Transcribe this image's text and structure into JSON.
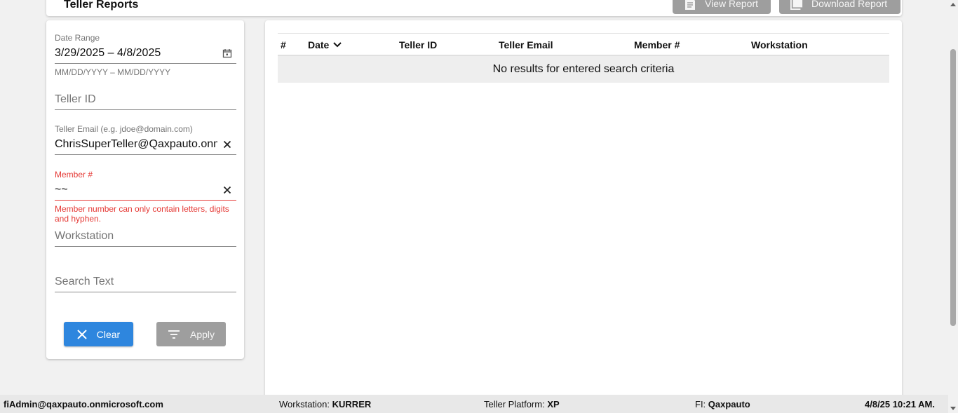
{
  "header": {
    "title": "Teller Reports",
    "view_report_label": "View Report",
    "download_report_label": "Download Report"
  },
  "filters": {
    "date_range": {
      "label": "Date Range",
      "value": "3/29/2025 – 4/8/2025",
      "helper": "MM/DD/YYYY – MM/DD/YYYY"
    },
    "teller_id": {
      "placeholder": "Teller ID"
    },
    "teller_email": {
      "label": "Teller Email (e.g. jdoe@domain.com)",
      "value": "ChrisSuperTeller@Qaxpauto.onmicrosoft.com"
    },
    "member": {
      "label": "Member #",
      "value": "~~",
      "error": "Member number can only contain letters, digits and hyphen."
    },
    "workstation": {
      "placeholder": "Workstation"
    },
    "search_text": {
      "placeholder": "Search Text"
    },
    "clear_label": "Clear",
    "apply_label": "Apply"
  },
  "table": {
    "columns": [
      "#",
      "Date",
      "Teller ID",
      "Teller Email",
      "Member #",
      "Workstation"
    ],
    "empty_message": "No results for entered search criteria"
  },
  "status_bar": {
    "user": "fiAdmin@qaxpauto.onmicrosoft.com",
    "workstation_label": "Workstation:",
    "workstation_value": "KURRER",
    "platform_label": "Teller Platform:",
    "platform_value": "XP",
    "fi_label": "FI:",
    "fi_value": "Qaxpauto",
    "datetime": "4/8/25 10:21 AM."
  },
  "colors": {
    "primary": "#2e86de",
    "error": "#e53935",
    "disabled": "#9e9e9e"
  }
}
